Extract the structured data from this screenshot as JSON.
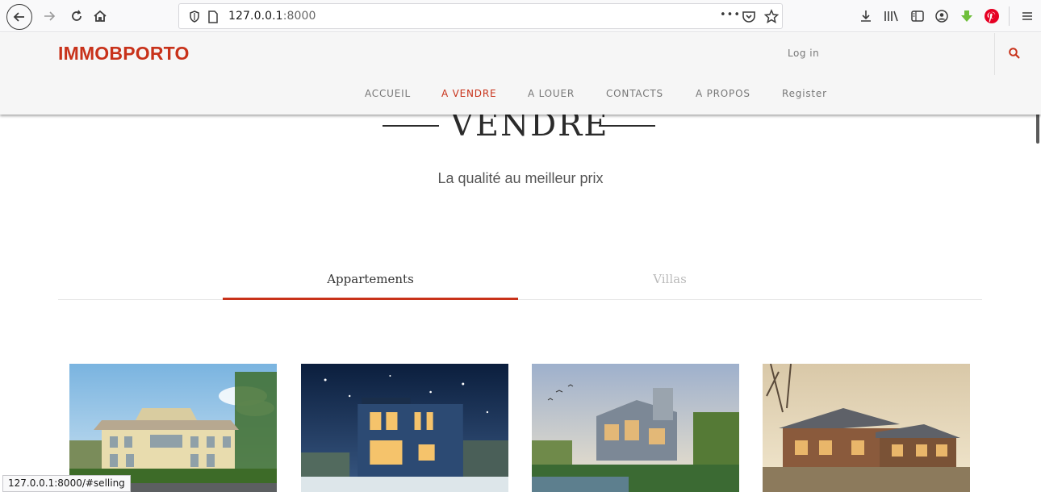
{
  "browser": {
    "url_host": "127.0.0.1",
    "url_port": ":8000",
    "url_more": "•••",
    "status_url": "127.0.0.1:8000/#selling"
  },
  "site": {
    "brand": "IMMOBPORTO",
    "login": "Log in",
    "nav": [
      "ACCUEIL",
      "A VENDRE",
      "A LOUER",
      "CONTACTS",
      "A PROPOS",
      "Register"
    ],
    "active_nav": "A VENDRE"
  },
  "content": {
    "section_title": "VENDRE",
    "subtitle": "La qualité au meilleur prix",
    "tabs": [
      {
        "label": "Appartements",
        "active": true
      },
      {
        "label": "Villas",
        "active": false
      }
    ]
  },
  "listings": [
    {
      "icon": "beige-mansion-photo"
    },
    {
      "icon": "blue-house-night-photo"
    },
    {
      "icon": "modern-house-lake-photo"
    },
    {
      "icon": "wooden-house-photo"
    }
  ],
  "colors": {
    "accent": "#c8321a",
    "header_bg": "#f6f6f6",
    "toolbar_bg": "#f9f9fa"
  }
}
